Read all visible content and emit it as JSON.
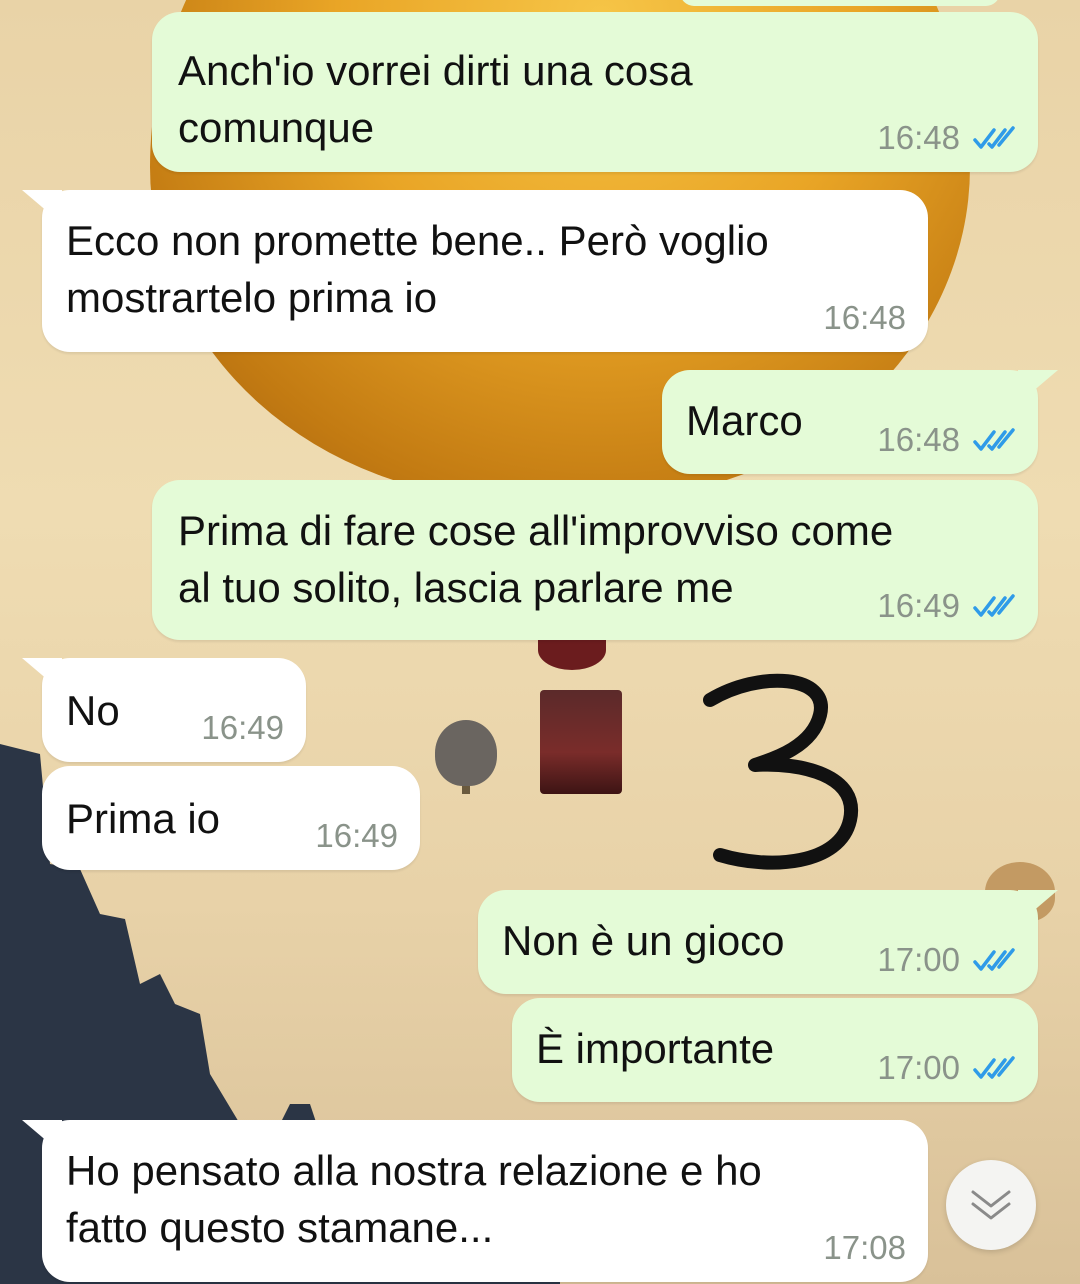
{
  "colors": {
    "outgoing_bubble": "#e4fbd7",
    "incoming_bubble": "#ffffff",
    "read_ticks": "#2f9be8",
    "timestamp": "#8a938a"
  },
  "overlay": {
    "handwritten_number": "3"
  },
  "messages": [
    {
      "direction": "outgoing",
      "text": "Anch'io vorrei dirti una cosa\ncomunque",
      "time": "16:48",
      "status": "read",
      "status_icon": "double-check-icon"
    },
    {
      "direction": "incoming",
      "text": "Ecco non promette bene.. Però voglio\nmostrartelo prima io",
      "time": "16:48"
    },
    {
      "direction": "outgoing",
      "text": "Marco",
      "time": "16:48",
      "status": "read",
      "status_icon": "double-check-icon"
    },
    {
      "direction": "outgoing",
      "text": "Prima di fare cose all'improvviso come\nal tuo solito, lascia parlare me",
      "time": "16:49",
      "status": "read",
      "status_icon": "double-check-icon"
    },
    {
      "direction": "incoming",
      "text": "No",
      "time": "16:49"
    },
    {
      "direction": "incoming",
      "text": "Prima io",
      "time": "16:49"
    },
    {
      "direction": "outgoing",
      "text": "Non è un gioco",
      "time": "17:00",
      "status": "read",
      "status_icon": "double-check-icon"
    },
    {
      "direction": "outgoing",
      "text": "È importante",
      "time": "17:00",
      "status": "read",
      "status_icon": "double-check-icon"
    },
    {
      "direction": "incoming",
      "text": "Ho pensato alla nostra relazione e ho\nfatto questo stamane...",
      "time": "17:08"
    }
  ],
  "scroll_button": {
    "icon": "chevron-down-icon"
  }
}
